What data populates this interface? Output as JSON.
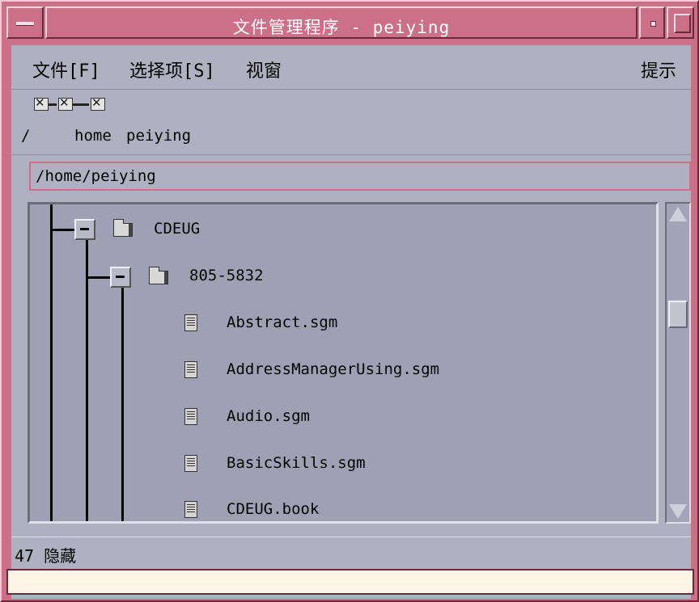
{
  "window": {
    "title": "文件管理程序 - peiying",
    "accent_color": "#cc7088"
  },
  "menubar": {
    "file": "文件[F]",
    "options": "选择项[S]",
    "view": "视窗",
    "help": "提示"
  },
  "iconic_path": {
    "root_label": "/",
    "segments": [
      "home",
      "peiying"
    ]
  },
  "path_field": {
    "value": "/home/peiying"
  },
  "tree": {
    "items": [
      {
        "label": "CDEUG",
        "icon": "folder-icon",
        "expanded": true
      },
      {
        "label": "805-5832",
        "icon": "folder-icon",
        "expanded": true
      },
      {
        "label": "Abstract.sgm",
        "icon": "document-icon"
      },
      {
        "label": "AddressManagerUsing.sgm",
        "icon": "document-icon"
      },
      {
        "label": "Audio.sgm",
        "icon": "document-icon"
      },
      {
        "label": "BasicSkills.sgm",
        "icon": "document-icon"
      },
      {
        "label": "CDEUG.book",
        "icon": "document-icon"
      }
    ]
  },
  "status": {
    "text": "47 隐藏"
  }
}
